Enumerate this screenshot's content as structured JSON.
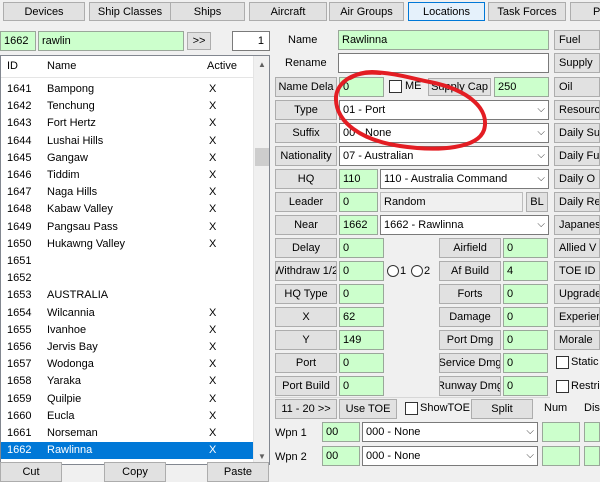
{
  "tabs": [
    "Devices",
    "Ship Classes",
    "Ships",
    "Aircraft",
    "Air Groups",
    "Locations",
    "Task Forces",
    "Pil"
  ],
  "active_tab": "Locations",
  "search": {
    "id_value": "1662",
    "text_value": "rawlin",
    "nav_button": ">>",
    "page_value": "1"
  },
  "list": {
    "headers": {
      "id": "ID",
      "name": "Name",
      "active": "Active"
    },
    "rows": [
      {
        "id": "1641",
        "name": "Bampong",
        "active": "X"
      },
      {
        "id": "1642",
        "name": "Tenchung",
        "active": "X"
      },
      {
        "id": "1643",
        "name": "Fort Hertz",
        "active": "X"
      },
      {
        "id": "1644",
        "name": "Lushai Hills",
        "active": "X"
      },
      {
        "id": "1645",
        "name": "Gangaw",
        "active": "X"
      },
      {
        "id": "1646",
        "name": "Tiddim",
        "active": "X"
      },
      {
        "id": "1647",
        "name": "Naga Hills",
        "active": "X"
      },
      {
        "id": "1648",
        "name": "Kabaw Valley",
        "active": "X"
      },
      {
        "id": "1649",
        "name": "Pangsau Pass",
        "active": "X"
      },
      {
        "id": "1650",
        "name": "Hukawng Valley",
        "active": "X"
      },
      {
        "id": "1651",
        "name": "",
        "active": ""
      },
      {
        "id": "1652",
        "name": "",
        "active": ""
      },
      {
        "id": "1653",
        "name": "AUSTRALIA",
        "active": ""
      },
      {
        "id": "1654",
        "name": "Wilcannia",
        "active": "X"
      },
      {
        "id": "1655",
        "name": "Ivanhoe",
        "active": "X"
      },
      {
        "id": "1656",
        "name": "Jervis Bay",
        "active": "X"
      },
      {
        "id": "1657",
        "name": "Wodonga",
        "active": "X"
      },
      {
        "id": "1658",
        "name": "Yaraka",
        "active": "X"
      },
      {
        "id": "1659",
        "name": "Quilpie",
        "active": "X"
      },
      {
        "id": "1660",
        "name": "Eucla",
        "active": "X"
      },
      {
        "id": "1661",
        "name": "Norseman",
        "active": "X"
      },
      {
        "id": "1662",
        "name": "Rawlinna",
        "active": "X"
      }
    ],
    "selected_id": "1662"
  },
  "bottom_buttons": {
    "cut": "Cut",
    "copy": "Copy",
    "paste": "Paste"
  },
  "form": {
    "name_label": "Name",
    "name_value": "Rawlinna",
    "rename_label": "Rename",
    "rename_value": "",
    "name_delay_label": "Name Dela",
    "name_delay_value": "0",
    "me_label": "ME",
    "supply_cap_label": "Supply Cap",
    "supply_cap_value": "250",
    "type_label": "Type",
    "type_value": "01 - Port",
    "suffix_label": "Suffix",
    "suffix_value": "00 - None",
    "nationality_label": "Nationality",
    "nationality_value": "07 - Australian",
    "hq_label": "HQ",
    "hq_value": "110",
    "hq_select": "110 - Australia Command",
    "leader_label": "Leader",
    "leader_value": "0",
    "leader_name": "Random",
    "bl_label": "BL",
    "near_label": "Near",
    "near_value": "1662",
    "near_select": "1662 - Rawlinna",
    "delay_label": "Delay",
    "delay_value": "0",
    "withdraw_label": "Withdraw 1/2",
    "withdraw_value": "0",
    "radio1": "1",
    "radio2": "2",
    "hq_type_label": "HQ Type",
    "hq_type_value": "0",
    "x_label": "X",
    "x_value": "62",
    "y_label": "Y",
    "y_value": "149",
    "port_label": "Port",
    "port_value": "0",
    "port_build_label": "Port Build",
    "port_build_value": "0",
    "airfield_label": "Airfield",
    "airfield_value": "0",
    "af_build_label": "Af Build",
    "af_build_value": "4",
    "forts_label": "Forts",
    "forts_value": "0",
    "damage_label": "Damage",
    "damage_value": "0",
    "port_dmg_label": "Port Dmg",
    "port_dmg_value": "0",
    "service_dmg_label": "Service Dmg",
    "service_dmg_value": "0",
    "runway_dmg_label": "Runway Dmg",
    "runway_dmg_value": "0",
    "range_button": "11 - 20 >>",
    "use_toe_button": "Use TOE",
    "show_toe_label": "ShowTOE",
    "split_button": "Split",
    "num_label": "Num",
    "dis_label": "Dis",
    "wpn1_label": "Wpn 1",
    "wpn1_value": "00",
    "wpn1_select": "000 - None",
    "wpn2_label": "Wpn 2",
    "wpn2_value": "00",
    "wpn2_select": "000 - None"
  },
  "right_column": [
    "Fuel",
    "Supply",
    "Oil",
    "Resourc",
    "Daily Sup",
    "Daily Fu",
    "Daily O",
    "Daily Re",
    "Japanese",
    "Allied V",
    "TOE ID",
    "Upgrade T",
    "Experien",
    "Morale"
  ],
  "right_checks": [
    "Static A",
    "Restrict"
  ],
  "colors": {
    "field_green": "#ccffcc",
    "selection_blue": "#0078d7",
    "annotation_red": "#e31d23"
  }
}
